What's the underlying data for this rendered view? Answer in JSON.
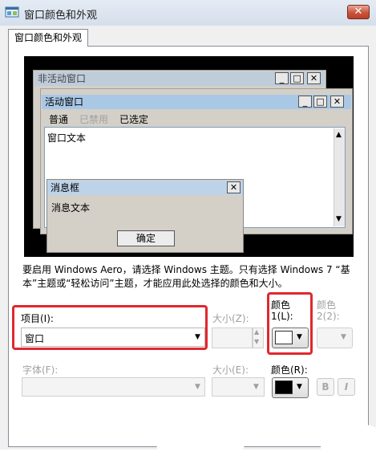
{
  "window": {
    "title": "窗口颜色和外观",
    "close_glyph": "✕"
  },
  "tabs": [
    {
      "label": "窗口颜色和外观"
    }
  ],
  "preview": {
    "inactive_title": "非活动窗口",
    "active_title": "活动窗口",
    "menu": [
      "普通",
      "已禁用",
      "已选定"
    ],
    "window_text": "窗口文本",
    "msgbox_title": "消息框",
    "msgbox_text": "消息文本",
    "ok_label": "确定",
    "caption_buttons": [
      "_",
      "□",
      "✕"
    ],
    "scroll_up": "▲",
    "scroll_down": "▼"
  },
  "explanation": "要启用 Windows Aero，请选择 Windows 主题。只有选择 Windows 7 “基本”主题或“轻松访问”主题，才能应用此处选择的颜色和大小。",
  "form": {
    "item_label": "项目(I):",
    "item_value": "窗口",
    "size_label_1": "大小(Z):",
    "color1_label_line1": "颜色",
    "color1_label_line2": "1(L):",
    "color2_label_line1": "颜色",
    "color2_label_line2": "2(2):",
    "font_label": "字体(F):",
    "size_label_2": "大小(E):",
    "font_color_label": "颜色(R):",
    "bold_label": "B",
    "italic_label": "I",
    "dropdown_arrow": "▼",
    "spin_up": "▲",
    "spin_down": "▼"
  },
  "colors": {
    "color1": "#ffffff",
    "font_color": "#000000",
    "highlight": "#e0282f"
  }
}
